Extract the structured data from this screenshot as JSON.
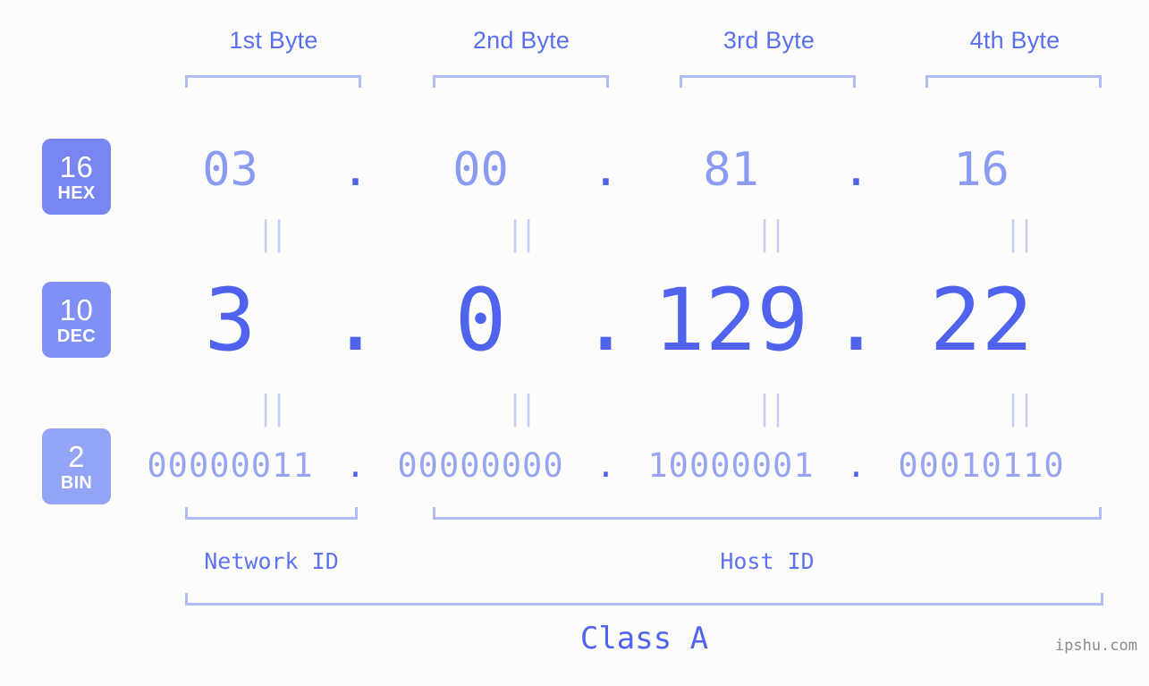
{
  "theme": {
    "background": "#fcfdfa",
    "accent_strong": "#4f63ee",
    "accent_mid": "#8c9bf2",
    "accent_light": "#b0bcf5",
    "badge_hex_bg": "#7986f2",
    "badge_dec_bg": "#8190f4",
    "badge_bin_bg": "#93a4f7",
    "watermark_color": "#8a8a8a"
  },
  "byte_headers": [
    {
      "label": "1st Byte"
    },
    {
      "label": "2nd Byte"
    },
    {
      "label": "3rd Byte"
    },
    {
      "label": "4th Byte"
    }
  ],
  "badges": [
    {
      "number": "16",
      "unit": "HEX"
    },
    {
      "number": "10",
      "unit": "DEC"
    },
    {
      "number": "2",
      "unit": "BIN"
    }
  ],
  "separator": ".",
  "equals_glyph": "||",
  "rows": {
    "hex": {
      "base": "16",
      "system": "HEX",
      "octets": [
        "03",
        "00",
        "81",
        "16"
      ]
    },
    "dec": {
      "base": "10",
      "system": "DEC",
      "octets": [
        "3",
        "0",
        "129",
        "22"
      ]
    },
    "bin": {
      "base": "2",
      "system": "BIN",
      "octets": [
        "00000011",
        "00000000",
        "10000001",
        "00010110"
      ]
    }
  },
  "ip_address": {
    "dotted_decimal": "3.0.129.22",
    "dotted_hex": "03.00.81.16",
    "dotted_binary": "00000011.00000000.10000001.00010110"
  },
  "partitions": {
    "network_id_label": "Network ID",
    "host_id_label": "Host ID",
    "network_id_bytes": 1,
    "host_id_bytes": 3
  },
  "class": {
    "label": "Class A"
  },
  "watermark": {
    "text": "ipshu.com"
  }
}
